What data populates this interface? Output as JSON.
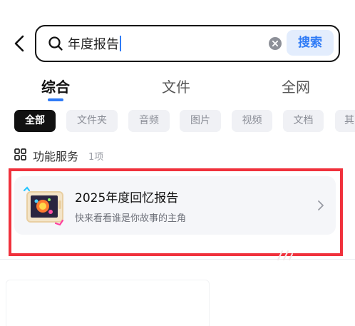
{
  "search": {
    "query": "年度报告",
    "button_label": "搜索"
  },
  "tabs": [
    {
      "label": "综合",
      "active": true
    },
    {
      "label": "文件",
      "active": false
    },
    {
      "label": "全网",
      "active": false
    }
  ],
  "chips": [
    {
      "label": "全部",
      "active": true
    },
    {
      "label": "文件夹",
      "active": false
    },
    {
      "label": "音频",
      "active": false
    },
    {
      "label": "图片",
      "active": false
    },
    {
      "label": "视频",
      "active": false
    },
    {
      "label": "文档",
      "active": false
    },
    {
      "label": "其",
      "active": false
    }
  ],
  "section": {
    "title": "功能服务",
    "count": "1项"
  },
  "result": {
    "title": "2025年度回忆报告",
    "subtitle": "快来看看谁是你故事的主角"
  },
  "colors": {
    "accent": "#2f7bf6",
    "highlight": "#f0313c",
    "chip_bg": "#f0f1f5",
    "card_bg": "#f5f6f9"
  },
  "icons": [
    "back-arrow-icon",
    "search-icon",
    "clear-icon",
    "grid-icon",
    "chevron-right-icon"
  ]
}
